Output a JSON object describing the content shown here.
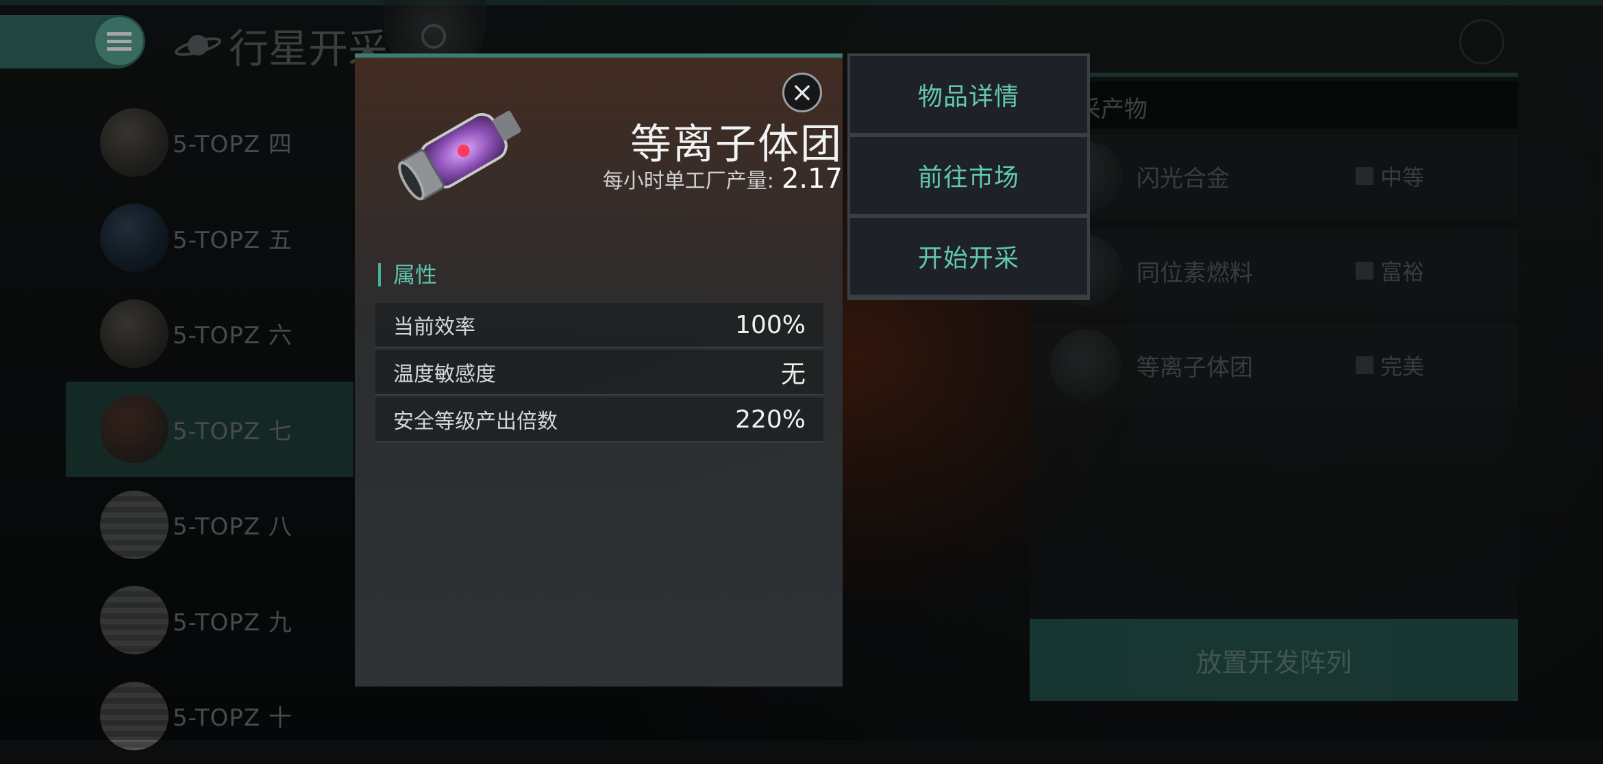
{
  "header": {
    "title": "行星开采"
  },
  "planets": [
    {
      "name": "5-TOPZ 四",
      "type": "rock"
    },
    {
      "name": "5-TOPZ 五",
      "type": "ocean"
    },
    {
      "name": "5-TOPZ 六",
      "type": "rock"
    },
    {
      "name": "5-TOPZ 七",
      "type": "lava",
      "selected": true
    },
    {
      "name": "5-TOPZ 八",
      "type": "gas"
    },
    {
      "name": "5-TOPZ 九",
      "type": "gas"
    },
    {
      "name": "5-TOPZ 十",
      "type": "gas"
    }
  ],
  "resources_panel": {
    "heading": "采产物",
    "items": [
      {
        "name": "闪光合金",
        "grade": "中等"
      },
      {
        "name": "同位素燃料",
        "grade": "富裕"
      },
      {
        "name": "等离子体团",
        "grade": "完美"
      }
    ],
    "place_button": "放置开发阵列"
  },
  "dialog": {
    "item_name": "等离子体团",
    "production_label": "每小时单工厂产量:",
    "production_value": "2.17",
    "attributes_title": "属性",
    "attributes": [
      {
        "label": "当前效率",
        "value": "100%"
      },
      {
        "label": "温度敏感度",
        "value": "无"
      },
      {
        "label": "安全等级产出倍数",
        "value": "220%"
      }
    ]
  },
  "actions": [
    {
      "label": "物品详情"
    },
    {
      "label": "前往市场"
    },
    {
      "label": "开始开采"
    }
  ],
  "colors": {
    "accent": "#5fc3ad",
    "menu_teal": "#3e8a7c"
  }
}
